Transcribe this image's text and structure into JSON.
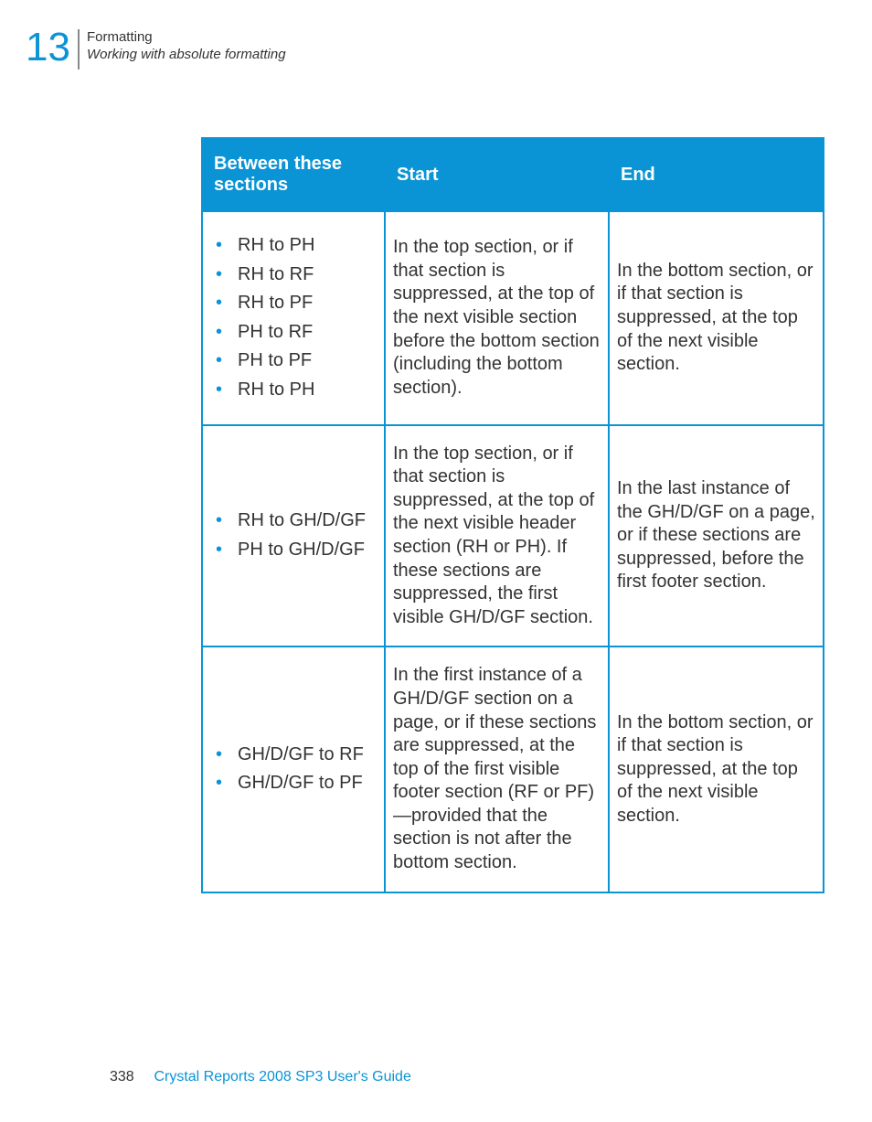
{
  "header": {
    "chapter_number": "13",
    "title": "Formatting",
    "subtitle": "Working with absolute formatting"
  },
  "table": {
    "headers": {
      "col1": "Between these sections",
      "col2": "Start",
      "col3": "End"
    },
    "rows": [
      {
        "bullets": [
          "RH to PH",
          "RH to RF",
          "RH to PF",
          "PH to RF",
          "PH to PF",
          "RH to PH"
        ],
        "start": "In the top section, or if that section is suppressed, at the top of the next visible section before the bottom section (including the bottom section).",
        "end": "In the bottom section, or if that section is suppressed, at the top of the next visible section."
      },
      {
        "bullets": [
          "RH to GH/D/GF",
          "PH to GH/D/GF"
        ],
        "start": "In the top section, or if that section is suppressed, at the top of the next visible header section (RH or PH). If these sections are suppressed, the first visible GH/D/GF section.",
        "end": "In the last instance of the GH/D/GF on a page, or if these sections are suppressed, before the first footer section."
      },
      {
        "bullets": [
          "GH/D/GF to RF",
          "GH/D/GF to PF"
        ],
        "start": "In the first instance of a GH/D/GF section on a page, or if these sections are suppressed, at the top of the first visible footer section (RF or PF)—provided that the section is not after the bottom section.",
        "end": "In the bottom section, or if that section is suppressed, at the top of the next visible section."
      }
    ]
  },
  "footer": {
    "page_number": "338",
    "doc_title": "Crystal Reports 2008 SP3 User's Guide"
  }
}
